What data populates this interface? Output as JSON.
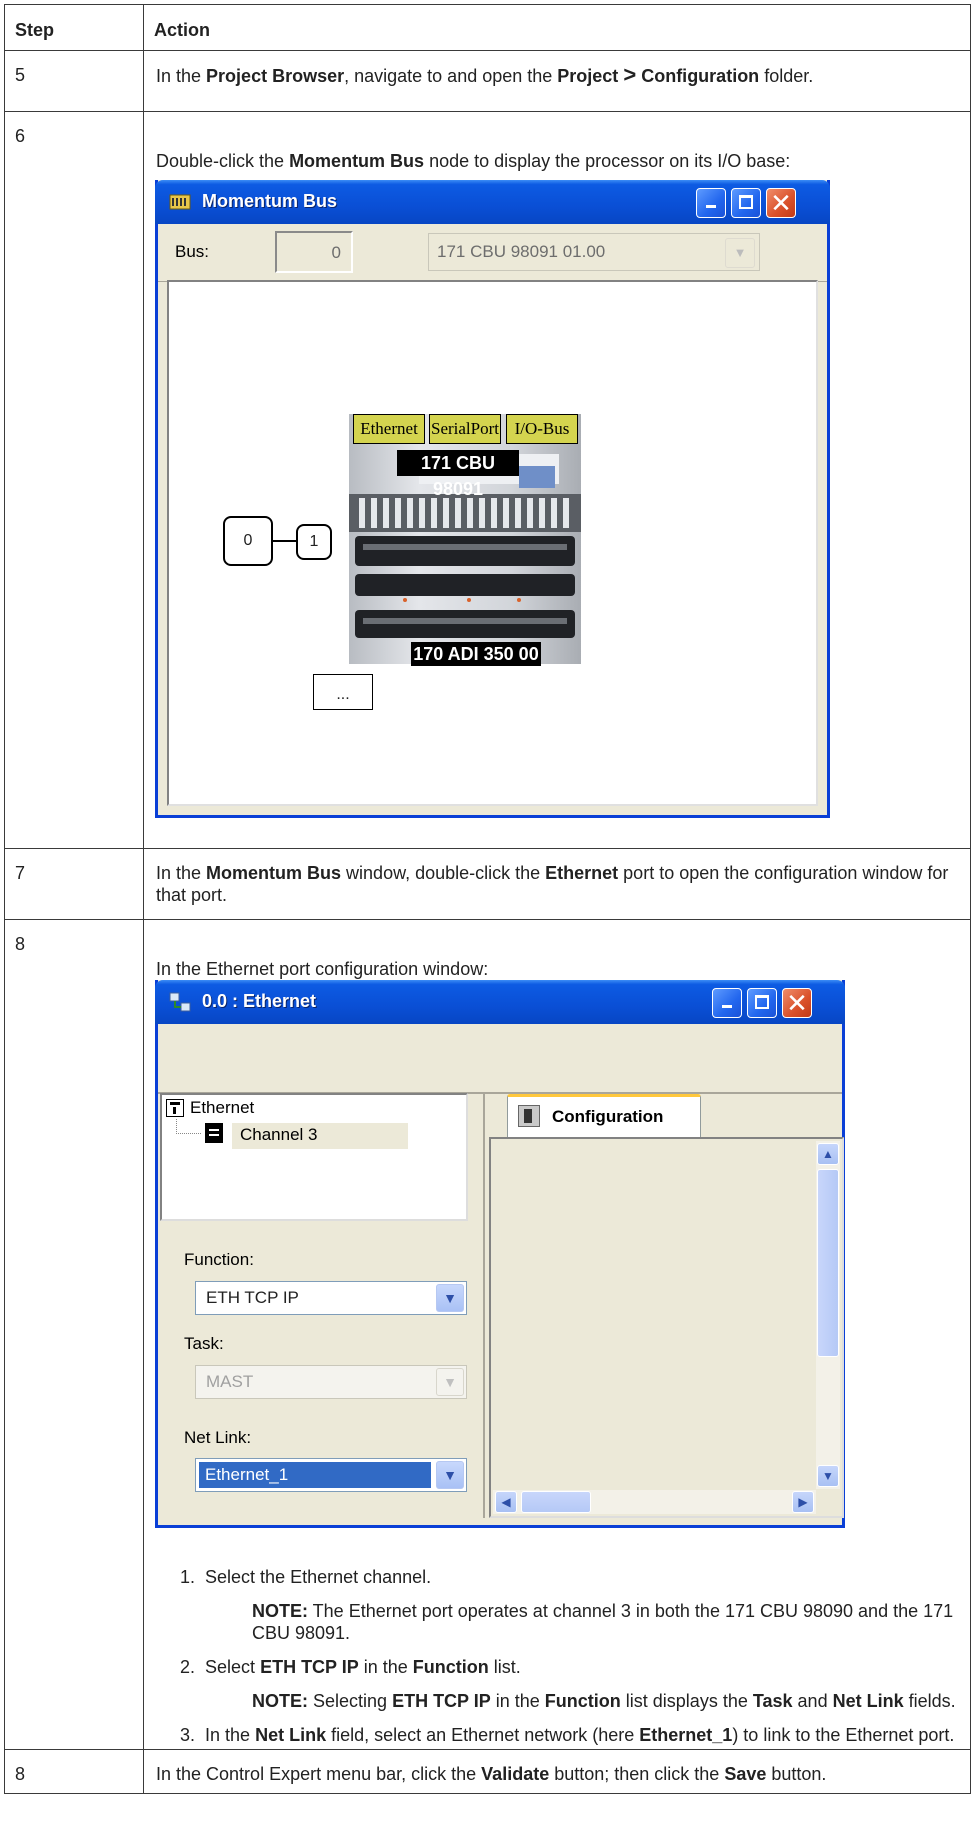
{
  "table": {
    "headers": [
      "Step",
      "Action"
    ],
    "rows": [
      {
        "step": "5"
      },
      {
        "step": "6"
      },
      {
        "step": "7"
      },
      {
        "step": "8"
      },
      {
        "step": "8"
      }
    ]
  },
  "step5": {
    "t1": "In the ",
    "b1": "Project Browser",
    "t2": ", navigate to and open the ",
    "b2": "Project",
    "gt": ">",
    "b3": "Configuration",
    "t3": " folder."
  },
  "step6": {
    "t1": "Double-click the ",
    "b1": "Momentum Bus",
    "t2": " node to display the processor on its I/O base:"
  },
  "mbus": {
    "title": "Momentum Bus",
    "bus_label": "Bus:",
    "bus_value": "0",
    "module_value": "171 CBU 98091 01.00",
    "ports": [
      "Ethernet",
      "SerialPort",
      "I/O-Bus"
    ],
    "cpu_label": "171 CBU 98091",
    "base_label": "170 ADI 350 00",
    "node0": "0",
    "node1": "1",
    "more": "..."
  },
  "step7": {
    "t1": "In the ",
    "b1": "Momentum Bus",
    "t2": " window, double-click the ",
    "b2": "Ethernet",
    "t3": " port to open the configuration window for that port."
  },
  "step8": {
    "intro": "In the Ethernet port configuration window:"
  },
  "eth": {
    "title": "0.0 : Ethernet",
    "tree_root": "Ethernet",
    "tree_child": "Channel 3",
    "tab": "Configuration",
    "function_label": "Function:",
    "function_value": "ETH TCP IP",
    "task_label": "Task:",
    "task_value": "MAST",
    "netlink_label": "Net Link:",
    "netlink_value": "Ethernet_1"
  },
  "list": {
    "i1_num": "1.",
    "i1": "Select the Ethernet channel.",
    "n1_b": "NOTE:",
    "n1": " The Ethernet port operates at channel 3 in both the 171 CBU 98090 and the 171 CBU 98091.",
    "i2_num": "2.",
    "i2_t1": "Select ",
    "i2_b1": "ETH TCP IP",
    "i2_t2": " in the ",
    "i2_b2": "Function",
    "i2_t3": " list.",
    "n2_b": "NOTE:",
    "n2_t1": " Selecting ",
    "n2_b1": "ETH TCP IP",
    "n2_t2": " in the ",
    "n2_b2": "Function",
    "n2_t3": " list displays the ",
    "n2_b3": "Task",
    "n2_t4": " and ",
    "n2_b4": "Net Link",
    "n2_t5": " fields.",
    "i3_num": "3.",
    "i3_t1": "In the ",
    "i3_b1": "Net Link",
    "i3_t2": " field, select an Ethernet network (here ",
    "i3_b2": "Ethernet_1",
    "i3_t3": ") to link to the Ethernet port."
  },
  "step8b": {
    "t1": "In the Control Expert menu bar, click the ",
    "b1": "Validate",
    "t2": " button; then click the ",
    "b2": "Save",
    "t3": " button."
  }
}
